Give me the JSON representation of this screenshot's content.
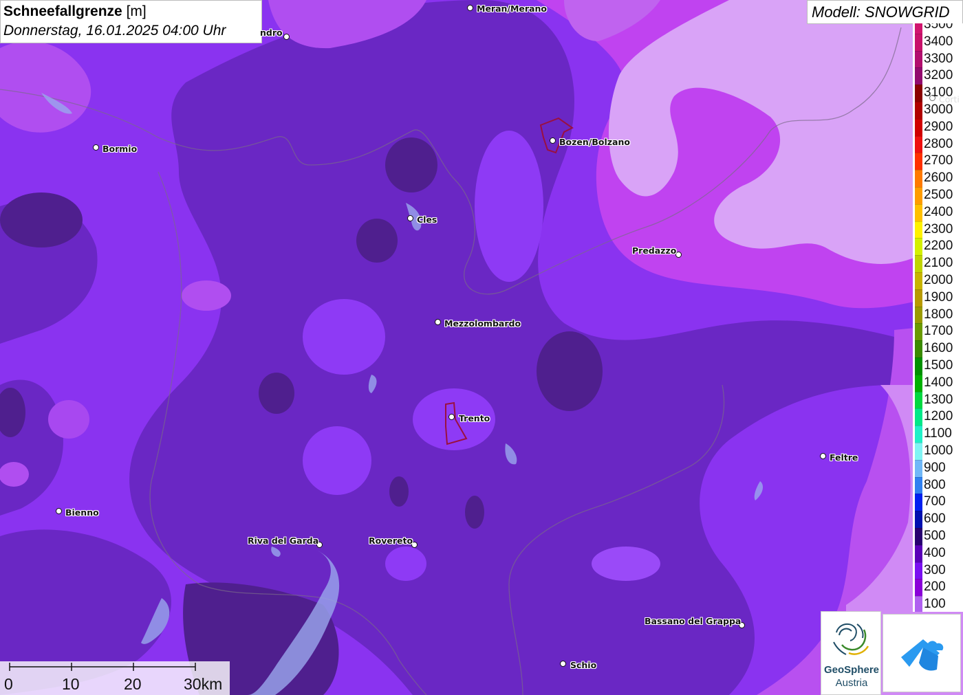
{
  "title": {
    "bold": "Schneefallgrenze",
    "unit": "[m]",
    "datetime": "Donnerstag, 16.01.2025 04:00 Uhr"
  },
  "model": "Modell: SNOWGRID",
  "legend": [
    {
      "label": "3500",
      "color": "#d0146e"
    },
    {
      "label": "3400",
      "color": "#c8116a"
    },
    {
      "label": "3300",
      "color": "#b20e6e"
    },
    {
      "label": "3200",
      "color": "#920a6e"
    },
    {
      "label": "3100",
      "color": "#8a0000"
    },
    {
      "label": "3000",
      "color": "#b00000"
    },
    {
      "label": "2900",
      "color": "#d00000"
    },
    {
      "label": "2800",
      "color": "#ee1010"
    },
    {
      "label": "2700",
      "color": "#ff3000"
    },
    {
      "label": "2600",
      "color": "#ff7a00"
    },
    {
      "label": "2500",
      "color": "#ff9c00"
    },
    {
      "label": "2400",
      "color": "#ffc000"
    },
    {
      "label": "2300",
      "color": "#fff200"
    },
    {
      "label": "2200",
      "color": "#d4f000"
    },
    {
      "label": "2100",
      "color": "#c0d400"
    },
    {
      "label": "2000",
      "color": "#c8b400"
    },
    {
      "label": "1900",
      "color": "#b89a00"
    },
    {
      "label": "1800",
      "color": "#9a9a00"
    },
    {
      "label": "1700",
      "color": "#6a9a00"
    },
    {
      "label": "1600",
      "color": "#3a8a00"
    },
    {
      "label": "1500",
      "color": "#009000"
    },
    {
      "label": "1400",
      "color": "#00b000"
    },
    {
      "label": "1300",
      "color": "#00d840"
    },
    {
      "label": "1200",
      "color": "#00e888"
    },
    {
      "label": "1100",
      "color": "#20f0c8"
    },
    {
      "label": "1000",
      "color": "#80f4f4"
    },
    {
      "label": "900",
      "color": "#70b8f8"
    },
    {
      "label": "800",
      "color": "#3080f0"
    },
    {
      "label": "700",
      "color": "#0020f0"
    },
    {
      "label": "600",
      "color": "#0010b0"
    },
    {
      "label": "500",
      "color": "#280070"
    },
    {
      "label": "400",
      "color": "#5a00b8"
    },
    {
      "label": "300",
      "color": "#7a10f0"
    },
    {
      "label": "200",
      "color": "#8a00d8"
    },
    {
      "label": "100",
      "color": "#b060f0"
    }
  ],
  "cities": [
    {
      "name": "Meran/Merano",
      "dot": [
        684,
        12
      ],
      "label": [
        693,
        5
      ]
    },
    {
      "name": "ndro",
      "dot": [
        417,
        54
      ],
      "label": [
        380,
        40
      ]
    },
    {
      "name": "Bormio",
      "dot": [
        140,
        215
      ],
      "label": [
        149,
        209
      ]
    },
    {
      "name": "Bozen/Bolzano",
      "dot": [
        804,
        205
      ],
      "label": [
        813,
        199
      ]
    },
    {
      "name": "Cles",
      "dot": [
        597,
        318
      ],
      "label": [
        606,
        312
      ]
    },
    {
      "name": "Predazzo",
      "dot": [
        987,
        371
      ],
      "label": [
        919,
        357
      ]
    },
    {
      "name": "Mezzolombardo",
      "dot": [
        637,
        469
      ],
      "label": [
        646,
        463
      ]
    },
    {
      "name": "Trento",
      "dot": [
        657,
        607
      ],
      "label": [
        667,
        601
      ]
    },
    {
      "name": "Feltre",
      "dot": [
        1197,
        664
      ],
      "label": [
        1206,
        658
      ]
    },
    {
      "name": "Bienno",
      "dot": [
        86,
        744
      ],
      "label": [
        95,
        738
      ]
    },
    {
      "name": "Riva del Garda",
      "dot": [
        465,
        793
      ],
      "label": [
        360,
        779
      ]
    },
    {
      "name": "Rovereto",
      "dot": [
        603,
        793
      ],
      "label": [
        536,
        779
      ]
    },
    {
      "name": "Bassano del Grappa",
      "dot": [
        1079,
        910
      ],
      "label": [
        937,
        896
      ]
    },
    {
      "name": "Schio",
      "dot": [
        819,
        966
      ],
      "label": [
        829,
        960
      ]
    },
    {
      "name": "Corti",
      "dot": [
        1356,
        143
      ],
      "label": [
        1365,
        137
      ]
    }
  ],
  "scale": {
    "labels": [
      "0",
      "10",
      "20",
      "30km"
    ]
  },
  "logo": {
    "name": "GeoSphere",
    "sub": "Austria"
  },
  "colors": {
    "dark": "#5e22a8",
    "mid": "#7a2ae0",
    "bright": "#8a33f0",
    "pink": "#c040ef",
    "lavender": "#d9a3f7",
    "darkest": "#4a1f86"
  }
}
